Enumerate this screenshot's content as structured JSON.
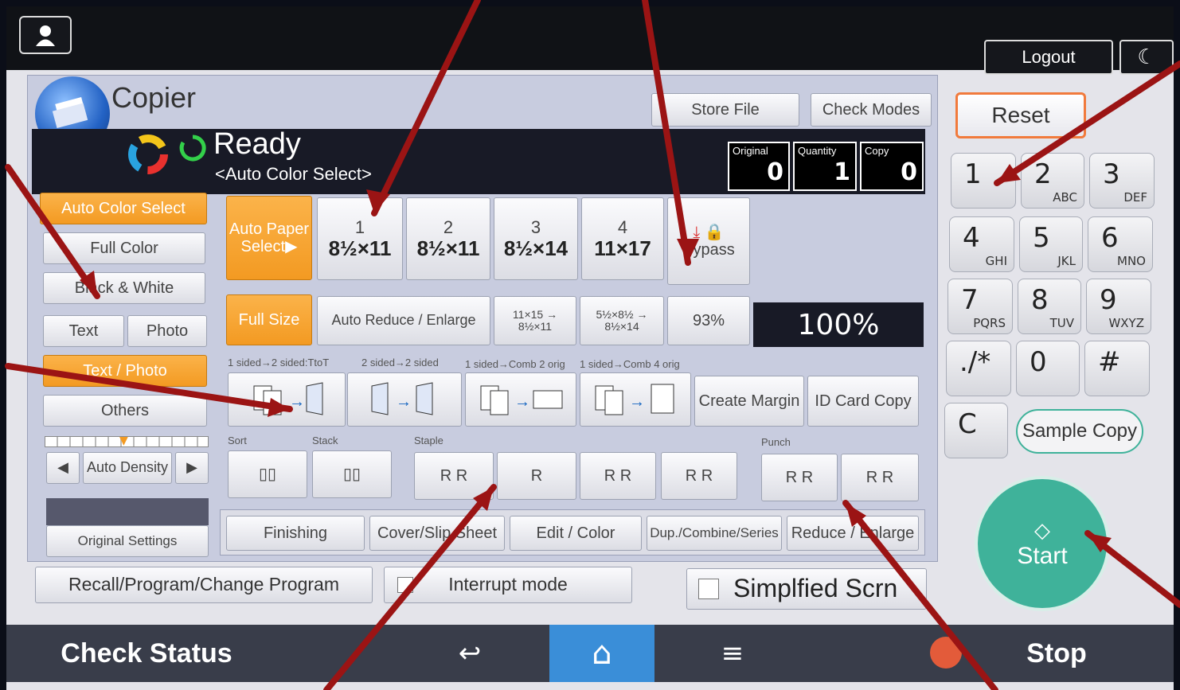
{
  "header": {
    "user_icon": "user-icon",
    "logout": "Logout",
    "reset": "Reset"
  },
  "copier": {
    "title": "Copier",
    "status": "Ready",
    "mode": "<Auto Color Select>",
    "store_file": "Store File",
    "check_modes": "Check Modes",
    "counters": [
      {
        "label": "Original",
        "value": "0"
      },
      {
        "label": "Quantity",
        "value": "1"
      },
      {
        "label": "Copy",
        "value": "0"
      }
    ]
  },
  "color_modes": [
    "Auto Color Select",
    "Full Color",
    "Black & White"
  ],
  "original_type": {
    "text": "Text",
    "photo": "Photo",
    "text_photo": "Text / Photo",
    "others": "Others"
  },
  "density": {
    "label": "Auto Density"
  },
  "original_settings": "Original Settings",
  "paper": {
    "auto": "Auto Paper Select▶",
    "trays": [
      {
        "n": "1",
        "size": "8½×11"
      },
      {
        "n": "2",
        "size": "8½×11"
      },
      {
        "n": "3",
        "size": "8½×14"
      },
      {
        "n": "4",
        "size": "11×17"
      }
    ],
    "bypass": "Bypass"
  },
  "ratio": {
    "full": "Full Size",
    "auto_reduce": "Auto Reduce / Enlarge",
    "r1": "11×15 → 8½×11",
    "r2": "5½×8½ → 8½×14",
    "pct": "93%",
    "current": "100%"
  },
  "duplex": {
    "labels": [
      "1 sided→2 sided:TtoT",
      "2 sided→2 sided",
      "1 sided→Comb 2 orig",
      "1 sided→Comb 4 orig"
    ],
    "create_margin": "Create Margin",
    "id_card": "ID Card Copy"
  },
  "finishing": {
    "sort": "Sort",
    "stack": "Stack",
    "staple": "Staple",
    "punch": "Punch"
  },
  "tabs": [
    "Finishing",
    "Cover/Slip Sheet",
    "Edit / Color",
    "Dup./Combine/Series",
    "Reduce / Enlarge"
  ],
  "bottom_buttons": {
    "recall": "Recall/Program/Change Program",
    "interrupt": "Interrupt mode",
    "simplified": "Simplfied Scrn"
  },
  "keypad": [
    {
      "d": "1",
      "l": ""
    },
    {
      "d": "2",
      "l": "ABC"
    },
    {
      "d": "3",
      "l": "DEF"
    },
    {
      "d": "4",
      "l": "GHI"
    },
    {
      "d": "5",
      "l": "JKL"
    },
    {
      "d": "6",
      "l": "MNO"
    },
    {
      "d": "7",
      "l": "PQRS"
    },
    {
      "d": "8",
      "l": "TUV"
    },
    {
      "d": "9",
      "l": "WXYZ"
    },
    {
      "d": "./*",
      "l": ""
    },
    {
      "d": "0",
      "l": ""
    },
    {
      "d": "#",
      "l": ""
    }
  ],
  "clear": "C",
  "sample_copy": "Sample Copy",
  "start": "Start",
  "system_bar": {
    "check_status": "Check Status",
    "stop": "Stop"
  },
  "colors": {
    "accent": "#f5a030",
    "start": "#3fb29a",
    "home": "#3a8ed8",
    "arrow": "#9b1414"
  }
}
